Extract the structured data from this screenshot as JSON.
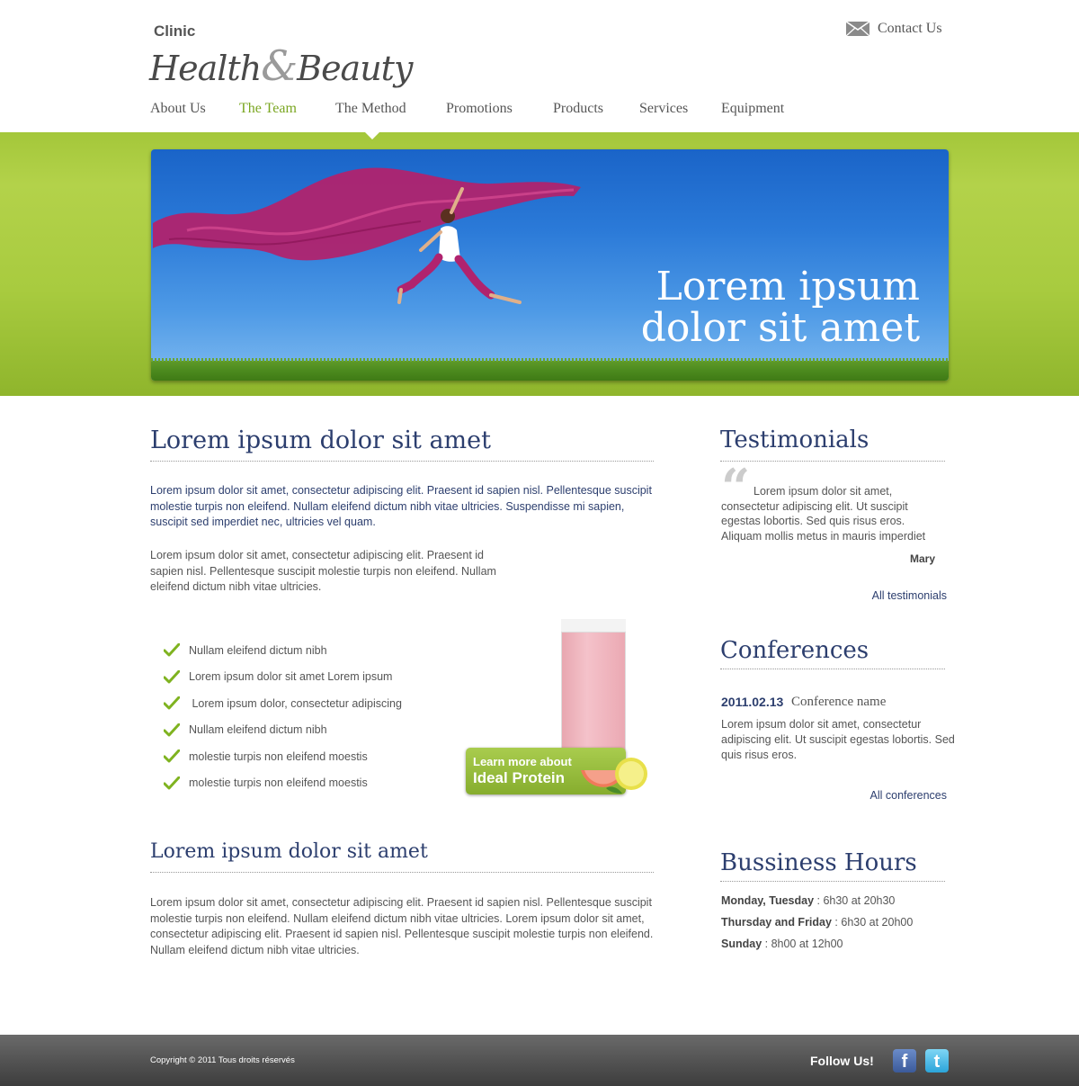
{
  "header": {
    "logo": {
      "clinic": "Clinic",
      "brand_part1": "Health",
      "brand_amp": "&",
      "brand_part2": "Beauty"
    },
    "contact_label": "Contact Us",
    "contact_icon": "envelope-icon"
  },
  "nav": {
    "items": [
      {
        "label": "About Us",
        "active": false
      },
      {
        "label": "The Team",
        "active": true
      },
      {
        "label": "The Method",
        "active": false
      },
      {
        "label": "Promotions",
        "active": false
      },
      {
        "label": "Products",
        "active": false
      },
      {
        "label": "Services",
        "active": false
      },
      {
        "label": "Equipment",
        "active": false
      }
    ],
    "active_color": "#7aa621"
  },
  "hero": {
    "headline_line1": "Lorem ipsum",
    "headline_line2": "dolor sit amet"
  },
  "main": {
    "section1": {
      "title": "Lorem ipsum dolor sit amet",
      "lead": "Lorem ipsum dolor sit amet, consectetur adipiscing elit. Praesent id sapien nisl. Pellentesque suscipit molestie turpis non eleifend. Nullam eleifend dictum nibh vitae ultricies. Suspendisse mi sapien, suscipit sed imperdiet nec, ultricies vel quam.",
      "paragraph": "Lorem ipsum dolor sit amet, consectetur adipiscing elit. Praesent id sapien nisl. Pellentesque suscipit molestie turpis non eleifend. Nullam eleifend dictum nibh vitae ultricies.",
      "checklist": [
        "Nullam eleifend dictum nibh",
        "Lorem ipsum dolor sit amet Lorem ipsum",
        " Lorem ipsum dolor, consectetur adipiscing",
        "Nullam eleifend dictum nibh",
        "molestie turpis non eleifend moestis",
        "molestie turpis non eleifend moestis"
      ],
      "promo": {
        "line1": "Learn more about",
        "line2": "Ideal Protein"
      }
    },
    "section2": {
      "title": "Lorem ipsum dolor sit amet",
      "paragraph": "Lorem ipsum dolor sit amet, consectetur adipiscing elit. Praesent id sapien nisl. Pellentesque suscipit molestie turpis non eleifend. Nullam eleifend dictum nibh vitae ultricies. Lorem ipsum dolor sit amet, consectetur adipiscing elit. Praesent id sapien nisl. Pellentesque suscipit molestie turpis non eleifend. Nullam eleifend dictum nibh vitae ultricies."
    }
  },
  "sidebar": {
    "testimonials": {
      "title": "Testimonials",
      "quote": "Lorem ipsum dolor sit amet, consectetur adipiscing elit. Ut suscipit egestas lobortis. Sed quis risus eros. Aliquam mollis metus in mauris imperdiet",
      "author": "Mary",
      "link": "All testimonials"
    },
    "conferences": {
      "title": "Conferences",
      "date": "2011.02.13",
      "name": "Conference name",
      "description": "Lorem ipsum dolor sit amet, consectetur adipiscing elit. Ut suscipit egestas lobortis. Sed quis risus eros.",
      "link": "All conferences"
    },
    "hours": {
      "title": "Bussiness Hours",
      "rows": [
        {
          "days": "Monday, Tuesday",
          "time": " : 6h30 at 20h30"
        },
        {
          "days": "Thursday and Friday",
          "time": " : 6h30 at 20h00"
        },
        {
          "days": "Sunday",
          "time": " : 8h00 at 12h00"
        }
      ]
    }
  },
  "footer": {
    "copyright": "Copyright © 2011 Tous droits réservés",
    "follow": "Follow Us!",
    "social": [
      {
        "icon": "facebook-icon",
        "glyph": "f"
      },
      {
        "icon": "twitter-icon",
        "glyph": "t"
      }
    ]
  },
  "colors": {
    "accent_green": "#7aa621",
    "heading_navy": "#2c3e6e",
    "text_gray": "#555555"
  }
}
